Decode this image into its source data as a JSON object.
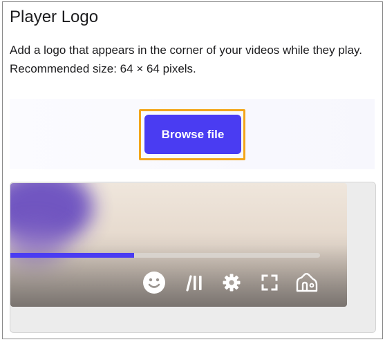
{
  "section": {
    "title": "Player Logo",
    "description": "Add a logo that appears in the corner of your videos while they play. Recommended size: 64 × 64 pixels."
  },
  "upload": {
    "button_label": "Browse file"
  },
  "preview": {
    "progress_fraction": 0.4,
    "accent_color": "#4a3cf2",
    "controls": [
      "smiley-icon",
      "pause-icon",
      "gear-icon",
      "fullscreen-icon",
      "logo-placeholder-icon"
    ]
  }
}
